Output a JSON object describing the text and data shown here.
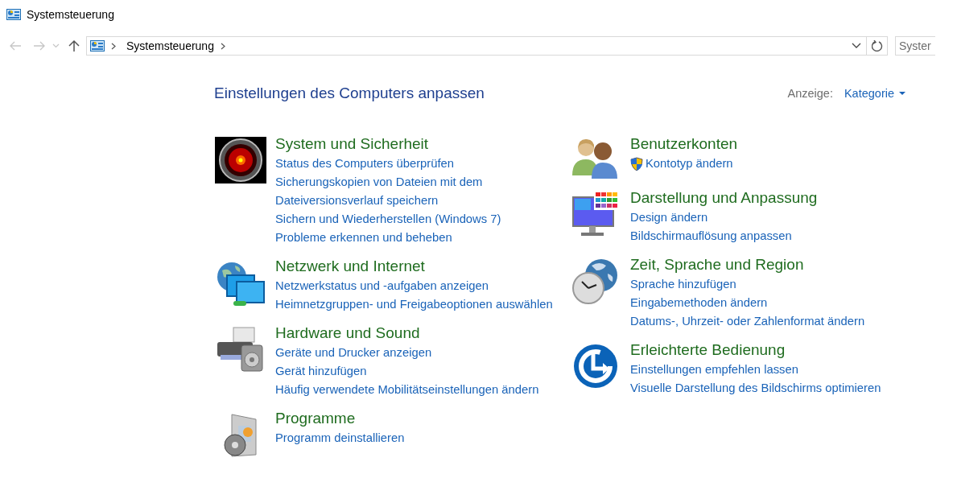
{
  "window": {
    "title": "Systemsteuerung"
  },
  "address_bar": {
    "breadcrumb": "Systemsteuerung"
  },
  "search": {
    "placeholder": "Syster"
  },
  "heading": "Einstellungen des Computers anpassen",
  "view": {
    "label": "Anzeige:",
    "value": "Kategorie"
  },
  "columns": [
    {
      "categories": [
        {
          "kind": "security",
          "title": "System und Sicherheit",
          "links": [
            {
              "text": "Status des Computers überprüfen",
              "shield": false
            },
            {
              "text": "Sicherungskopien von Dateien mit dem Dateiversionsverlauf speichern",
              "shield": false
            },
            {
              "text": "Sichern und Wiederherstellen (Windows 7)",
              "shield": false
            },
            {
              "text": "Probleme erkennen und beheben",
              "shield": false
            }
          ]
        },
        {
          "kind": "network",
          "title": "Netzwerk und Internet",
          "links": [
            {
              "text": "Netzwerkstatus und -aufgaben anzeigen",
              "shield": false
            },
            {
              "text": "Heimnetzgruppen- und Freigabeoptionen auswählen",
              "shield": false
            }
          ]
        },
        {
          "kind": "hardware",
          "title": "Hardware und Sound",
          "links": [
            {
              "text": "Geräte und Drucker anzeigen",
              "shield": false
            },
            {
              "text": "Gerät hinzufügen",
              "shield": false
            },
            {
              "text": "Häufig verwendete Mobilitätseinstellungen ändern",
              "shield": false
            }
          ]
        },
        {
          "kind": "programs",
          "title": "Programme",
          "links": [
            {
              "text": "Programm deinstallieren",
              "shield": false
            }
          ]
        }
      ]
    },
    {
      "categories": [
        {
          "kind": "users",
          "title": "Benutzerkonten",
          "links": [
            {
              "text": "Kontotyp ändern",
              "shield": true
            }
          ]
        },
        {
          "kind": "appearance",
          "title": "Darstellung und Anpassung",
          "links": [
            {
              "text": "Design ändern",
              "shield": false
            },
            {
              "text": "Bildschirmauflösung anpassen",
              "shield": false
            }
          ]
        },
        {
          "kind": "clock",
          "title": "Zeit, Sprache und Region",
          "links": [
            {
              "text": "Sprache hinzufügen",
              "shield": false
            },
            {
              "text": "Eingabemethoden ändern",
              "shield": false
            },
            {
              "text": "Datums-, Uhrzeit- oder Zahlenformat ändern",
              "shield": false
            }
          ]
        },
        {
          "kind": "ease",
          "title": "Erleichterte Bedienung",
          "links": [
            {
              "text": "Einstellungen empfehlen lassen",
              "shield": false
            },
            {
              "text": "Visuelle Darstellung des Bildschirms optimieren",
              "shield": false
            }
          ]
        }
      ]
    }
  ]
}
